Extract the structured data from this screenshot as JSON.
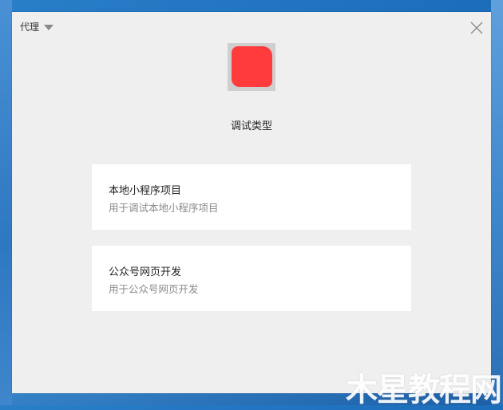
{
  "window": {
    "proxy_label": "代理",
    "title": "调试类型"
  },
  "options": [
    {
      "title": "本地小程序项目",
      "desc": "用于调试本地小程序项目"
    },
    {
      "title": "公众号网页开发",
      "desc": "用于公众号网页开发"
    }
  ],
  "watermark": "木星教程网",
  "icons": {
    "dropdown": "triangle-down-icon",
    "close": "close-icon",
    "avatar": "avatar-image"
  },
  "colors": {
    "window_bg": "#efefef",
    "card_bg": "#ffffff",
    "avatar_red": "#ff3b3b"
  }
}
